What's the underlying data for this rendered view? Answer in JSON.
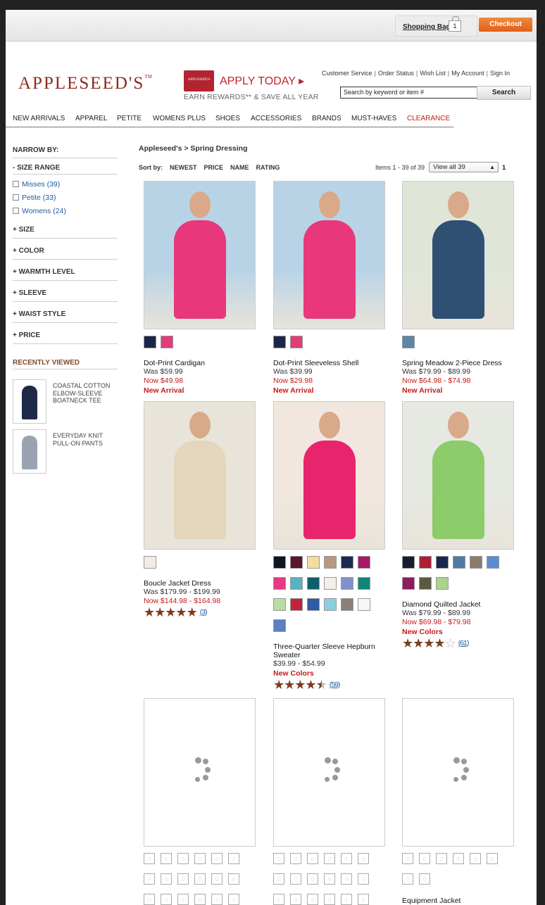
{
  "header": {
    "shopping_bag_label": "Shopping Bag",
    "bag_count": "1",
    "checkout_label": "Checkout",
    "logo_text": "APPLESEED'S",
    "logo_tm": "TM",
    "promo_card_text": "APPLESEED'S",
    "promo_title": "APPLY TODAY ▸",
    "promo_subtitle": "EARN REWARDS** & SAVE ALL YEAR",
    "util_links": [
      "Customer Service",
      "Order Status",
      "Wish List",
      "My Account",
      "Sign In"
    ],
    "search_placeholder": "Search by keyword or item #",
    "search_button": "Search"
  },
  "nav": [
    "NEW ARRIVALS",
    "APPAREL",
    "PETITE",
    "WOMENS PLUS",
    "SHOES",
    "ACCESSORIES",
    "BRANDS",
    "MUST-HAVES",
    "CLEARANCE"
  ],
  "sidebar": {
    "narrow_by": "NARROW BY:",
    "size_range": "- SIZE RANGE",
    "size_options": [
      "Misses (39)",
      "Petite (33)",
      "Womens (24)"
    ],
    "facets": [
      "+ SIZE",
      "+ COLOR",
      "+ WARMTH LEVEL",
      "+ SLEEVE",
      "+ WAIST STYLE",
      "+ PRICE"
    ],
    "recently_viewed": "RECENTLY VIEWED",
    "recent_items": [
      {
        "name": "COASTAL COTTON ELBOW-SLEEVE BOATNECK TEE",
        "color": "#1f2a48"
      },
      {
        "name": "EVERYDAY KNIT PULL-ON PANTS",
        "color": "#9aa4b0"
      }
    ]
  },
  "listing": {
    "breadcrumb": "Appleseed's  >  Spring Dressing",
    "sort_label": "Sort by:",
    "sort_options": [
      "NEWEST",
      "PRICE",
      "NAME",
      "RATING"
    ],
    "items_count": "Items 1 - 39 of 39",
    "view_all": "View all 39",
    "page": "1"
  },
  "products": [
    {
      "name": "Dot-Print Cardigan",
      "was": "Was $59.99",
      "now": "Now $49.98",
      "flag": "New Arrival",
      "swatches": [
        "#1c2548",
        "#e23d78"
      ],
      "img_bg": "#b9d3e6",
      "img_fg": "#e8377a"
    },
    {
      "name": "Dot-Print Sleeveless Shell",
      "was": "Was $39.99",
      "now": "Now $29.98",
      "flag": "New Arrival",
      "swatches": [
        "#1c2548",
        "#e23d78"
      ],
      "img_bg": "#b9d3e6",
      "img_fg": "#e8377a"
    },
    {
      "name": "Spring Meadow 2-Piece Dress",
      "was": "Was $79.99 - $89.99",
      "now": "Now $64.98 - $74.98",
      "flag": "New Arrival",
      "swatches": [
        "#5a86a8"
      ],
      "img_bg": "#dfe6d8",
      "img_fg": "#2f4f73"
    },
    {
      "name": "Boucle Jacket Dress",
      "was": "Was $179.99 - $199.99",
      "now": "Now $144.98 - $164.98",
      "rating": 5,
      "reviews": "(3)",
      "swatches": [
        "#f1ece2"
      ],
      "img_bg": "#e9e4d9",
      "img_fg": "#e4d6bc"
    },
    {
      "name": "Three-Quarter Sleeve Hepburn Sweater",
      "price": "$39.99 - $54.99",
      "flag": "New Colors",
      "rating": 4.5,
      "reviews": "(59)",
      "swatches": [
        "#0c1724",
        "#5c1430",
        "#f4dca2",
        "#b59a7e",
        "#1a2a52",
        "#a8186a",
        "#e83a80",
        "#5ab1c4",
        "#0f5e6a",
        "#f2efe9",
        "#8490cc",
        "#12857a",
        "#b9dca3",
        "#c4213c",
        "#2f5aa6",
        "#8ccfdf",
        "#8c7f77",
        "#f6f6f6",
        "#5b7fc0"
      ],
      "img_bg": "#f1e7de",
      "img_fg": "#e8256c"
    },
    {
      "name": "Diamond Quilted Jacket",
      "was": "Was $79.99 - $89.99",
      "now": "Now $69.98 - $79.98",
      "flag": "New Colors",
      "rating": 4,
      "reviews": "(61)",
      "swatches": [
        "#142030",
        "#b01e34",
        "#16284e",
        "#4f7aa6",
        "#8b7a6e",
        "#5a8ed4",
        "#8e1c5e",
        "#5a5a42",
        "#a8d48c"
      ],
      "img_bg": "#e6e8e2",
      "img_fg": "#8ccc6a"
    },
    {
      "name": "",
      "loading": true,
      "swatch_rows": 3,
      "last_row": 6
    },
    {
      "name": "",
      "loading": true,
      "swatch_rows": 3,
      "last_row": 6
    },
    {
      "name": "Equipment Jacket",
      "loading": true,
      "swatch_rows": 2,
      "last_row": 2
    }
  ]
}
